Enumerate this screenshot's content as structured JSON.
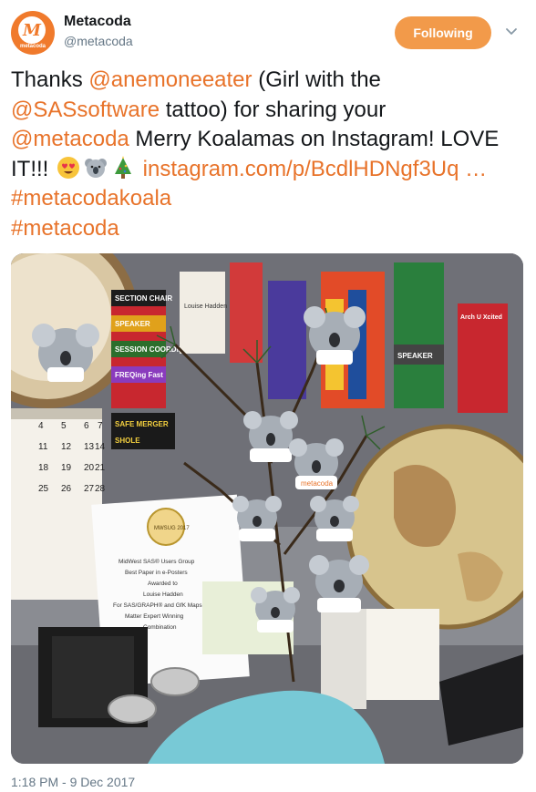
{
  "header": {
    "avatar_text": "metacoda",
    "avatar_letter": "M",
    "display_name": "Metacoda",
    "handle": "@metacoda",
    "follow_label": "Following"
  },
  "tweet": {
    "t1": "Thanks ",
    "mention1": "@anemoneeater",
    "t2": " (Girl with the ",
    "mention2": "@SASsoftware",
    "t3": " tattoo) for sharing your ",
    "mention3": "@metacoda",
    "t4": " Merry Koalamas on Instagram! LOVE IT!!! ",
    "link": "instagram.com/p/BcdlHDNgf3Uq …",
    "hashtag1": "#metacodakoala",
    "hashtag2": "#metacoda"
  },
  "photo": {
    "calendar_days": [
      "4",
      "5",
      "6",
      "7",
      "11",
      "12",
      "13",
      "14",
      "18",
      "19",
      "20",
      "21",
      "25",
      "26",
      "27",
      "28"
    ],
    "ribbons": [
      "SECTION CHAIR",
      "SPEAKER",
      "SESSION COORDINATOR",
      "FREQing Fast",
      "SAFE MERGER",
      "SHOLE",
      "SPEAKER",
      "Arch U Xcited"
    ],
    "certificate": {
      "seal": "MWSUG 2017",
      "lines": [
        "MidWest SAS® Users Group",
        "Best Paper in e-Posters",
        "Awarded to",
        "Louise Hadden",
        "For SAS/GRAPH® and GfK Maps: a",
        "Matter Expert Winning",
        "Combination"
      ]
    },
    "badge_name": "Louise Hadden",
    "koala_bib": "metacoda"
  },
  "timestamp": "1:18 PM - 9 Dec 2017",
  "colors": {
    "accent": "#e8732a",
    "follow_button": "#f29a4a",
    "muted": "#657786"
  }
}
